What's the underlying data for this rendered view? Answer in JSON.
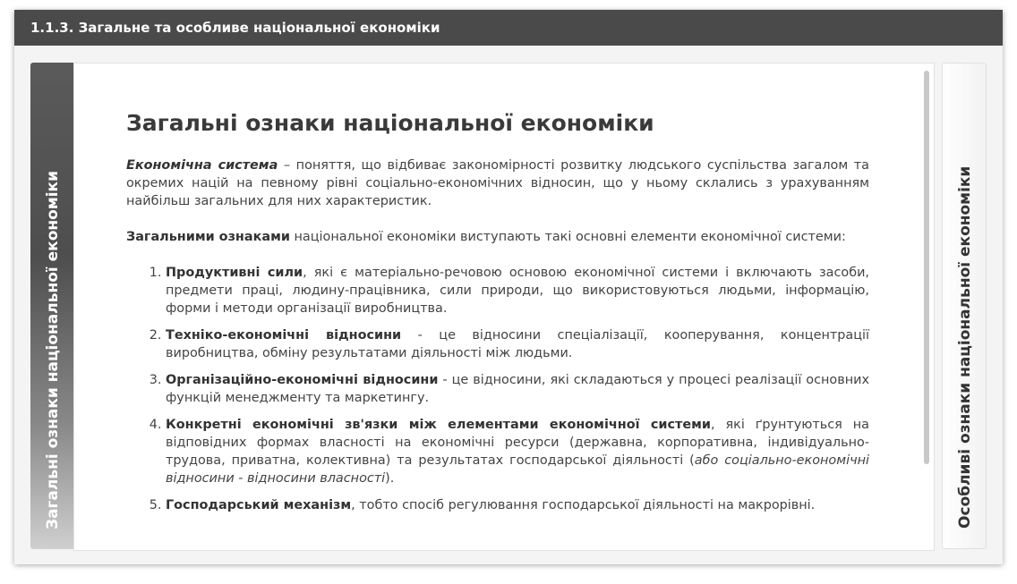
{
  "window": {
    "title": "1.1.3. Загальне та особливе національної економіки"
  },
  "tabs": {
    "left_label": "Загальні ознаки національної економіки",
    "right_label": "Особливі ознаки національної економіки"
  },
  "article": {
    "heading": "Загальні ознаки національної економіки",
    "p1": {
      "term": "Економічна система",
      "text": " – поняття, що відбиває закономірності розвитку людського суспільства загалом та окремих націй на певному рівні соціально-економічних відносин, що у ньому склались з урахуванням найбільш загальних для них характеристик."
    },
    "p2": {
      "term": "Загальними ознаками",
      "text": " національної економіки виступають такі основні елементи економічної системи:"
    },
    "items": [
      {
        "term": "Продуктивні сили",
        "text": ", які є матеріально-речовою основою економічної системи і включають засоби, предмети праці, людину-працівника, сили природи, що використовуються людьми, інформацію, форми і методи організації виробництва."
      },
      {
        "term": "Техніко-економічні відносини",
        "text": " - це відносини спеціалізації, кооперування, концентрації виробництва, обміну результатами діяльності між людьми."
      },
      {
        "term": "Організаційно-економічні відносини",
        "text": " - це відносини, які складаються у процесі реалізації основних функцій менеджменту та маркетингу."
      },
      {
        "term": "Конкретні економічні зв'язки між елементами економічної системи",
        "text": ", які ґрунтуються на відповідних формах власності на економічні ресурси (державна, корпоративна, індивідуально-трудова, приватна, колективна) та результатах господарської діяльності (",
        "italic": "або соціально-економічні відносини - відносини власності",
        "tail": ")."
      },
      {
        "term": "Господарський механізм",
        "text": ", тобто спосіб регулювання господарської діяльності на макрорівні."
      }
    ]
  }
}
